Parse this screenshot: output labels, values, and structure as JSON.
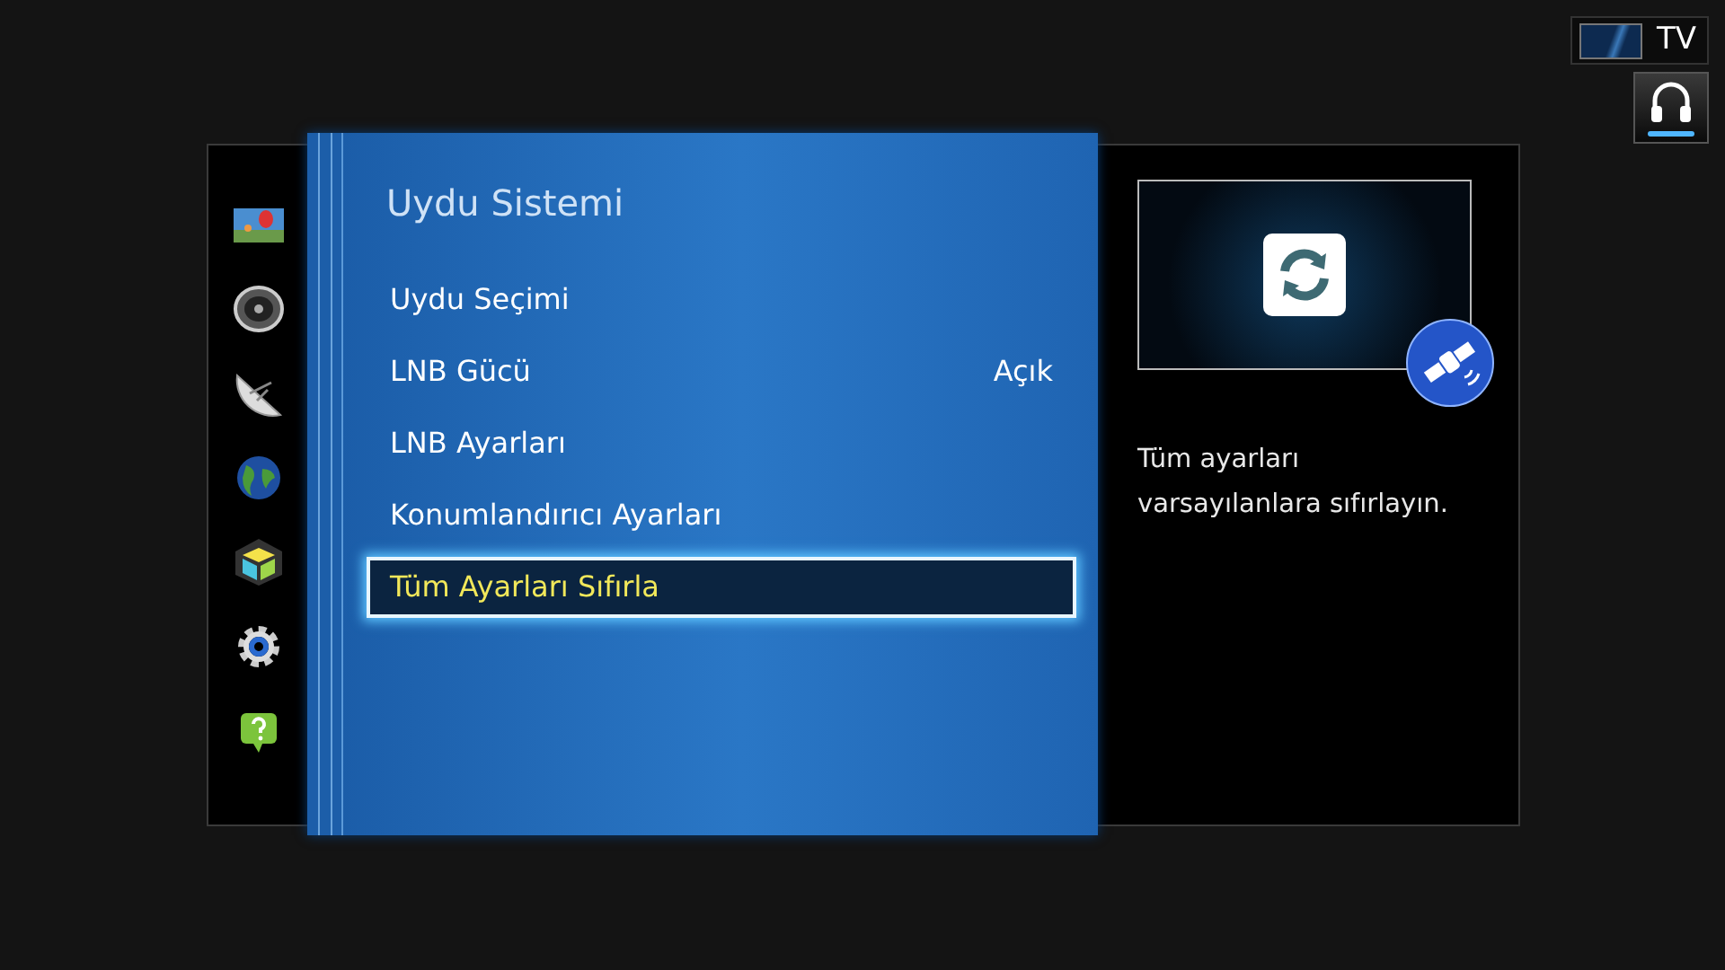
{
  "source_indicator": {
    "label": "TV"
  },
  "sidebar": {
    "items": [
      {
        "kind": "picture"
      },
      {
        "kind": "sound"
      },
      {
        "kind": "broadcast"
      },
      {
        "kind": "network"
      },
      {
        "kind": "smart"
      },
      {
        "kind": "system"
      },
      {
        "kind": "support"
      }
    ]
  },
  "menu": {
    "title": "Uydu Sistemi",
    "items": [
      {
        "label": "Uydu Seçimi",
        "selected": false
      },
      {
        "label": "LNB Gücü",
        "value": "Açık",
        "selected": false
      },
      {
        "label": "LNB Ayarları",
        "selected": false
      },
      {
        "label": "Konumlandırıcı Ayarları",
        "selected": false
      },
      {
        "label": "Tüm Ayarları Sıfırla",
        "selected": true
      }
    ]
  },
  "help": {
    "description": "Tüm ayarları varsayılanlara sıfırlayın."
  }
}
